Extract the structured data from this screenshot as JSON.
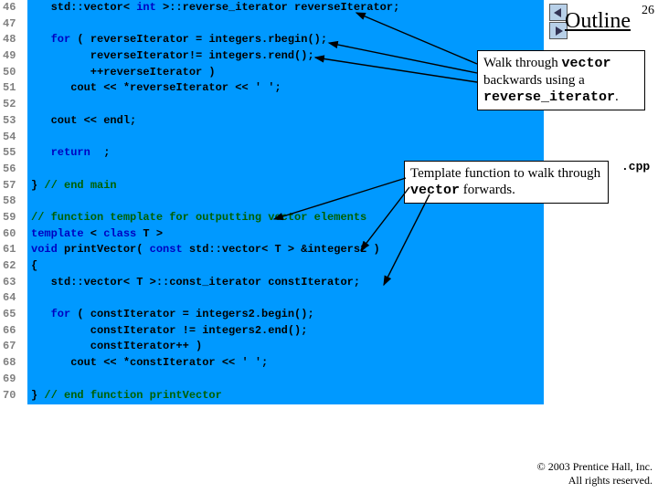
{
  "pageNumber": "26",
  "outline": "Outline",
  "fileSuffix": ".cpp",
  "callout1": {
    "pre": "Walk through ",
    "mono1": "vector",
    "mid": " backwards using a ",
    "mono2": "reverse_iterator",
    "end": "."
  },
  "callout2": {
    "pre": "Template function to walk through ",
    "mono": "vector",
    "end": " forwards."
  },
  "copyright": {
    "line1": "© 2003 Prentice Hall, Inc.",
    "line2": "All rights reserved."
  },
  "lineStart": 46,
  "lines": [
    [
      [
        "norm",
        "   std::vector< "
      ],
      [
        "kw",
        "int"
      ],
      [
        "norm",
        " >::reverse_iterator reverseIterator;"
      ]
    ],
    [],
    [
      [
        "norm",
        "   "
      ],
      [
        "kw",
        "for"
      ],
      [
        "norm",
        " ( reverseIterator = integers.rbegin();"
      ]
    ],
    [
      [
        "norm",
        "         reverseIterator!= integers.rend();"
      ]
    ],
    [
      [
        "norm",
        "         ++reverseIterator )"
      ]
    ],
    [
      [
        "norm",
        "      cout << *reverseIterator << "
      ],
      [
        "lit",
        "' '"
      ],
      [
        "norm",
        ";"
      ]
    ],
    [],
    [
      [
        "norm",
        "   cout << endl;"
      ]
    ],
    [],
    [
      [
        "norm",
        "   "
      ],
      [
        "kw",
        "return"
      ],
      [
        "norm",
        "  ;"
      ]
    ],
    [],
    [
      [
        "norm",
        "} "
      ],
      [
        "cmt",
        "// end main"
      ]
    ],
    [],
    [
      [
        "cmt",
        "// function template for outputting vector elements"
      ]
    ],
    [
      [
        "kw",
        "template"
      ],
      [
        "norm",
        " < "
      ],
      [
        "kw",
        "class"
      ],
      [
        "norm",
        " T >"
      ]
    ],
    [
      [
        "kw",
        "void"
      ],
      [
        "norm",
        " printVector( "
      ],
      [
        "kw",
        "const"
      ],
      [
        "norm",
        " std::vector< T > &integers2 )"
      ]
    ],
    [
      [
        "norm",
        "{"
      ]
    ],
    [
      [
        "norm",
        "   std::vector< T >::const_iterator constIterator;"
      ]
    ],
    [],
    [
      [
        "norm",
        "   "
      ],
      [
        "kw",
        "for"
      ],
      [
        "norm",
        " ( constIterator = integers2.begin();"
      ]
    ],
    [
      [
        "norm",
        "         constIterator != integers2.end();"
      ]
    ],
    [
      [
        "norm",
        "         constIterator++ )"
      ]
    ],
    [
      [
        "norm",
        "      cout << *constIterator << "
      ],
      [
        "lit",
        "' '"
      ],
      [
        "norm",
        ";"
      ]
    ],
    [],
    [
      [
        "norm",
        "} "
      ],
      [
        "cmt",
        "// end function printVector"
      ]
    ]
  ]
}
